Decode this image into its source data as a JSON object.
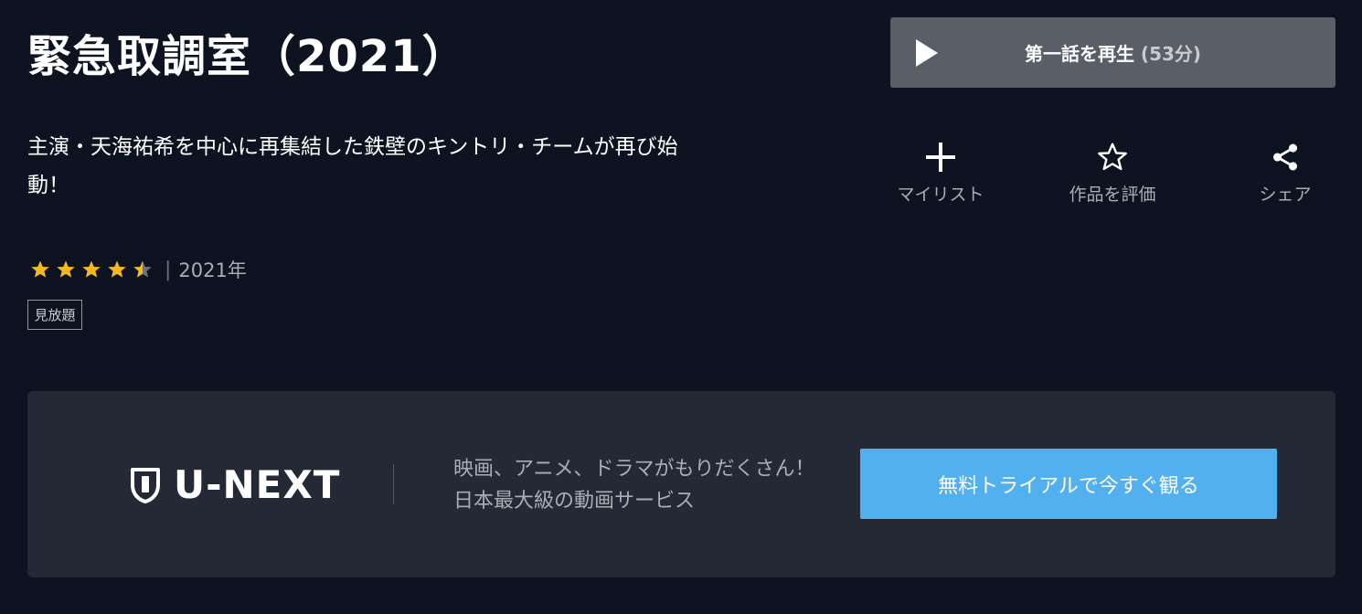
{
  "title": "緊急取調室（2021）",
  "play": {
    "label": "第一話を再生",
    "duration": "(53分)"
  },
  "description": "主演・天海祐希を中心に再集結した鉄壁のキントリ・チームが再び始動！",
  "actions": [
    {
      "label": "マイリスト",
      "icon": "plus-icon"
    },
    {
      "label": "作品を評価",
      "icon": "star-outline-icon"
    },
    {
      "label": "シェア",
      "icon": "share-icon"
    }
  ],
  "rating": {
    "value": 4.5,
    "max": 5,
    "separator": "|",
    "year": "2021年"
  },
  "badge": "見放題",
  "promo": {
    "logo": "U-NEXT",
    "tagline_line1": "映画、アニメ、ドラマがもりだくさん！",
    "tagline_line2": "日本最大級の動画サービス",
    "cta": "無料トライアルで今すぐ観る"
  },
  "colors": {
    "background": "#0d1320",
    "play_button": "#5a5e66",
    "promo_bg": "#242a35",
    "cta": "#53b0ee",
    "star": "#f5b820"
  }
}
